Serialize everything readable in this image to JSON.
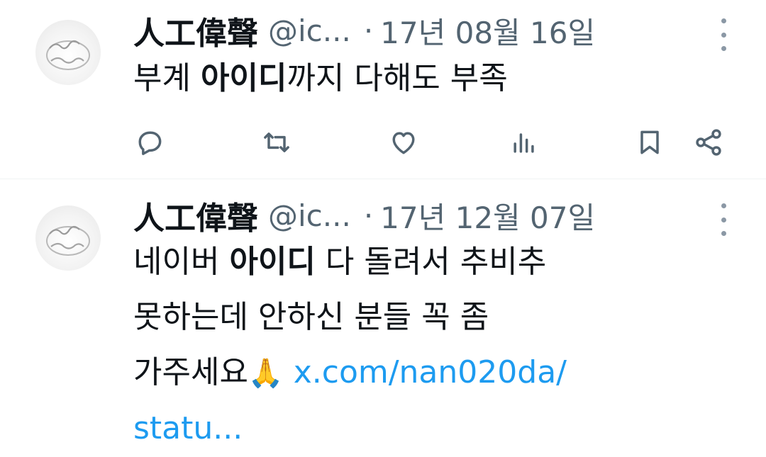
{
  "tweets": [
    {
      "name": "人工偉聲",
      "handle": "@ic...",
      "separator": "·",
      "date": "17년 08월 16일",
      "text_before": "부계 ",
      "text_bold": "아이디",
      "text_after": "까지 다해도 부족",
      "actions": [
        "reply-icon",
        "retweet-icon",
        "like-icon",
        "views-icon",
        "bookmark-icon",
        "share-icon"
      ]
    },
    {
      "name": "人工偉聲",
      "handle": "@ic...",
      "separator": "·",
      "date": "17년 12월 07일",
      "line1_before": "네이버 ",
      "line1_bold": "아이디",
      "line1_after": " 다 돌려서 추비추",
      "line2": "못하는데 안하신 분들 꼭 좀",
      "line3": "가주세요",
      "emoji": "🙏",
      "link_part1": " x.com/nan020da/",
      "link_part2": "statu..."
    }
  ],
  "colors": {
    "link": "#1d9bf0",
    "muted": "#536471",
    "text": "#0f1419"
  }
}
